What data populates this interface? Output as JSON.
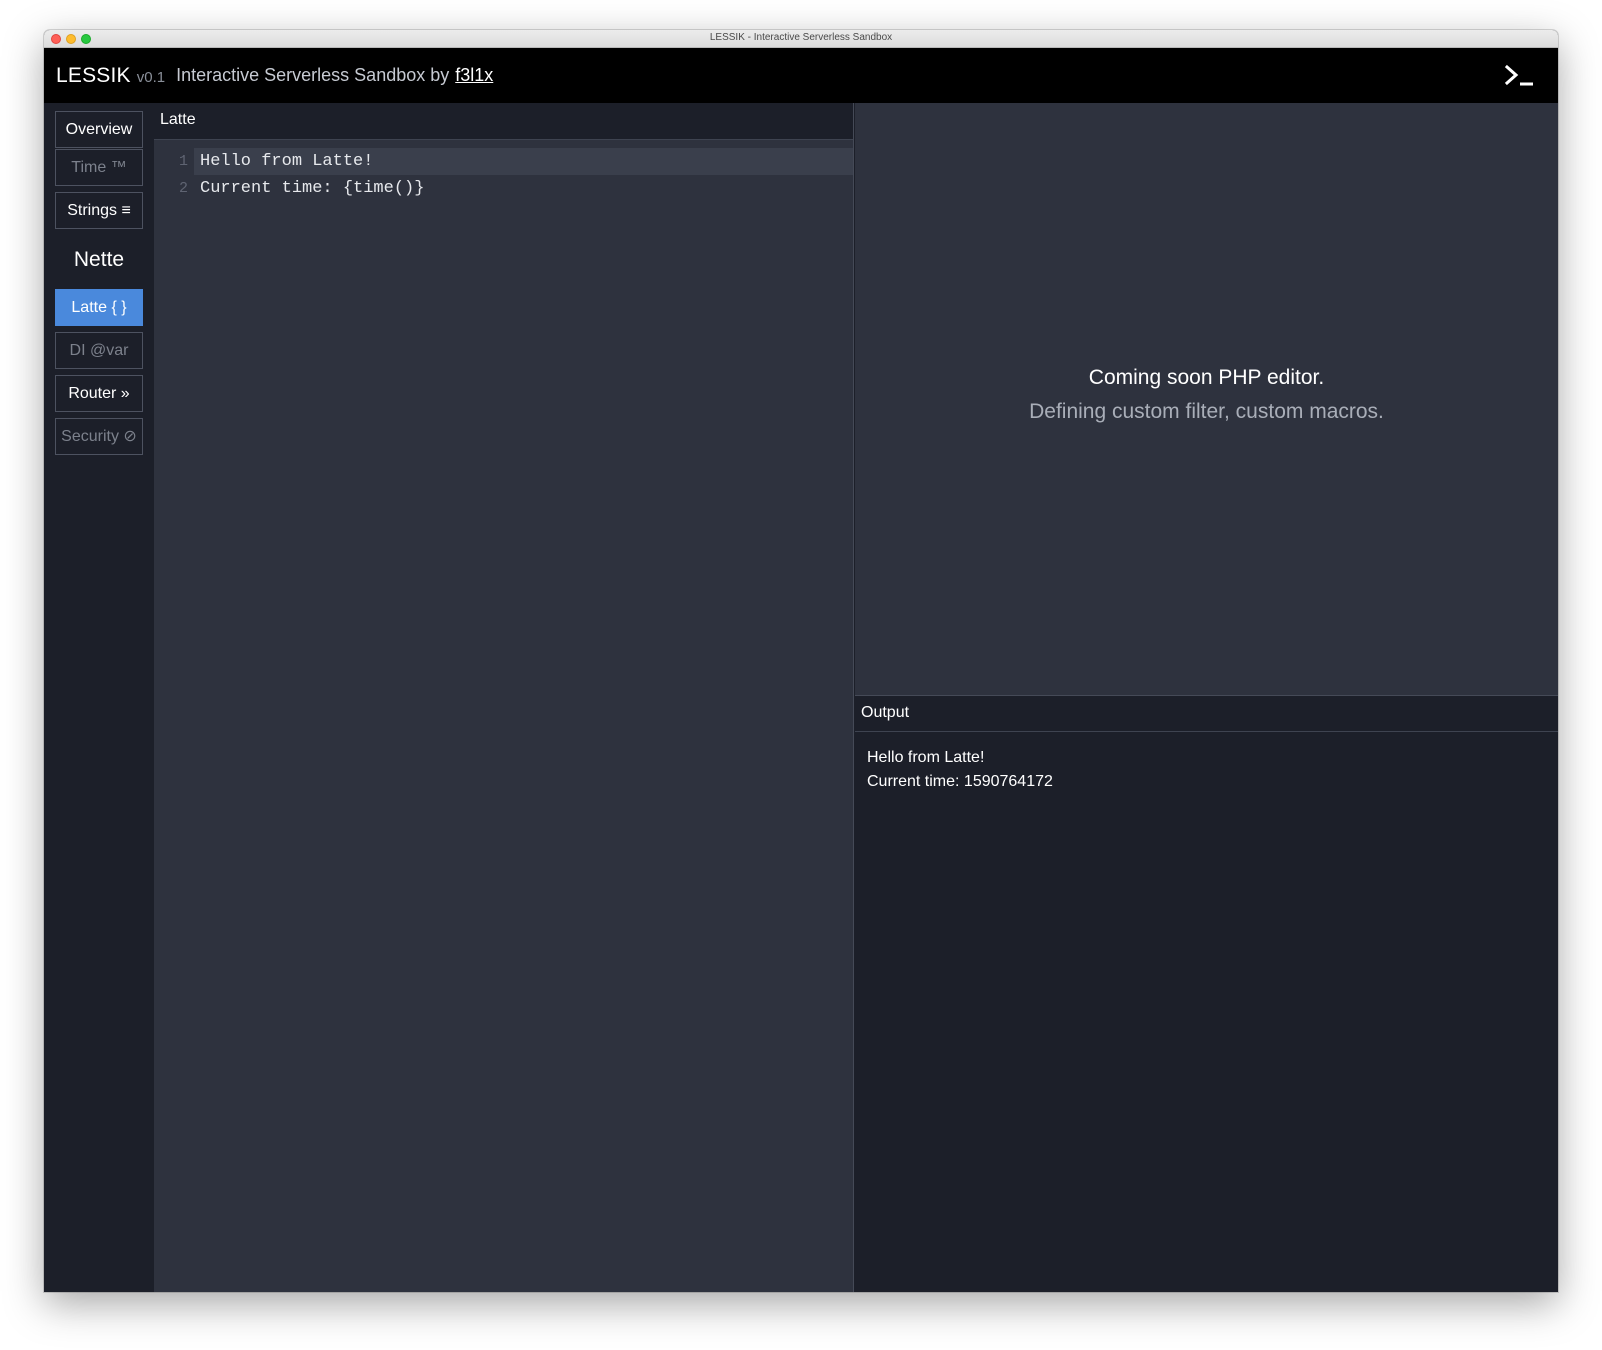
{
  "window": {
    "title": "LESSIK - Interactive Serverless Sandbox"
  },
  "header": {
    "brand": "LESSIK",
    "version": "v0.1",
    "tagline": "Interactive Serverless Sandbox by",
    "author": "f3l1x",
    "terminal_icon": "terminal-icon"
  },
  "sidebar": {
    "items": [
      {
        "label": "Overview"
      },
      {
        "label": "Time ™"
      },
      {
        "label": "Strings ≡"
      }
    ],
    "section": "Nette",
    "nette_items": [
      {
        "label": "Latte { }"
      },
      {
        "label": "DI @var"
      },
      {
        "label": "Router »"
      },
      {
        "label": "Security ⊘"
      }
    ],
    "active": "Latte { }"
  },
  "editor": {
    "title": "Latte",
    "lines": [
      {
        "num": "1",
        "text": "Hello from Latte!"
      },
      {
        "num": "2",
        "text": "Current time: {time()}"
      }
    ]
  },
  "php_panel": {
    "title": "Coming soon PHP editor.",
    "subtitle": "Defining custom filter, custom macros."
  },
  "output": {
    "title": "Output",
    "lines": [
      "Hello from Latte!",
      "Current time: 1590764172"
    ]
  },
  "colors": {
    "accent": "#4a89dc",
    "background": "#1c1f29",
    "editor_bg": "#2e323e",
    "appbar": "#000000"
  }
}
